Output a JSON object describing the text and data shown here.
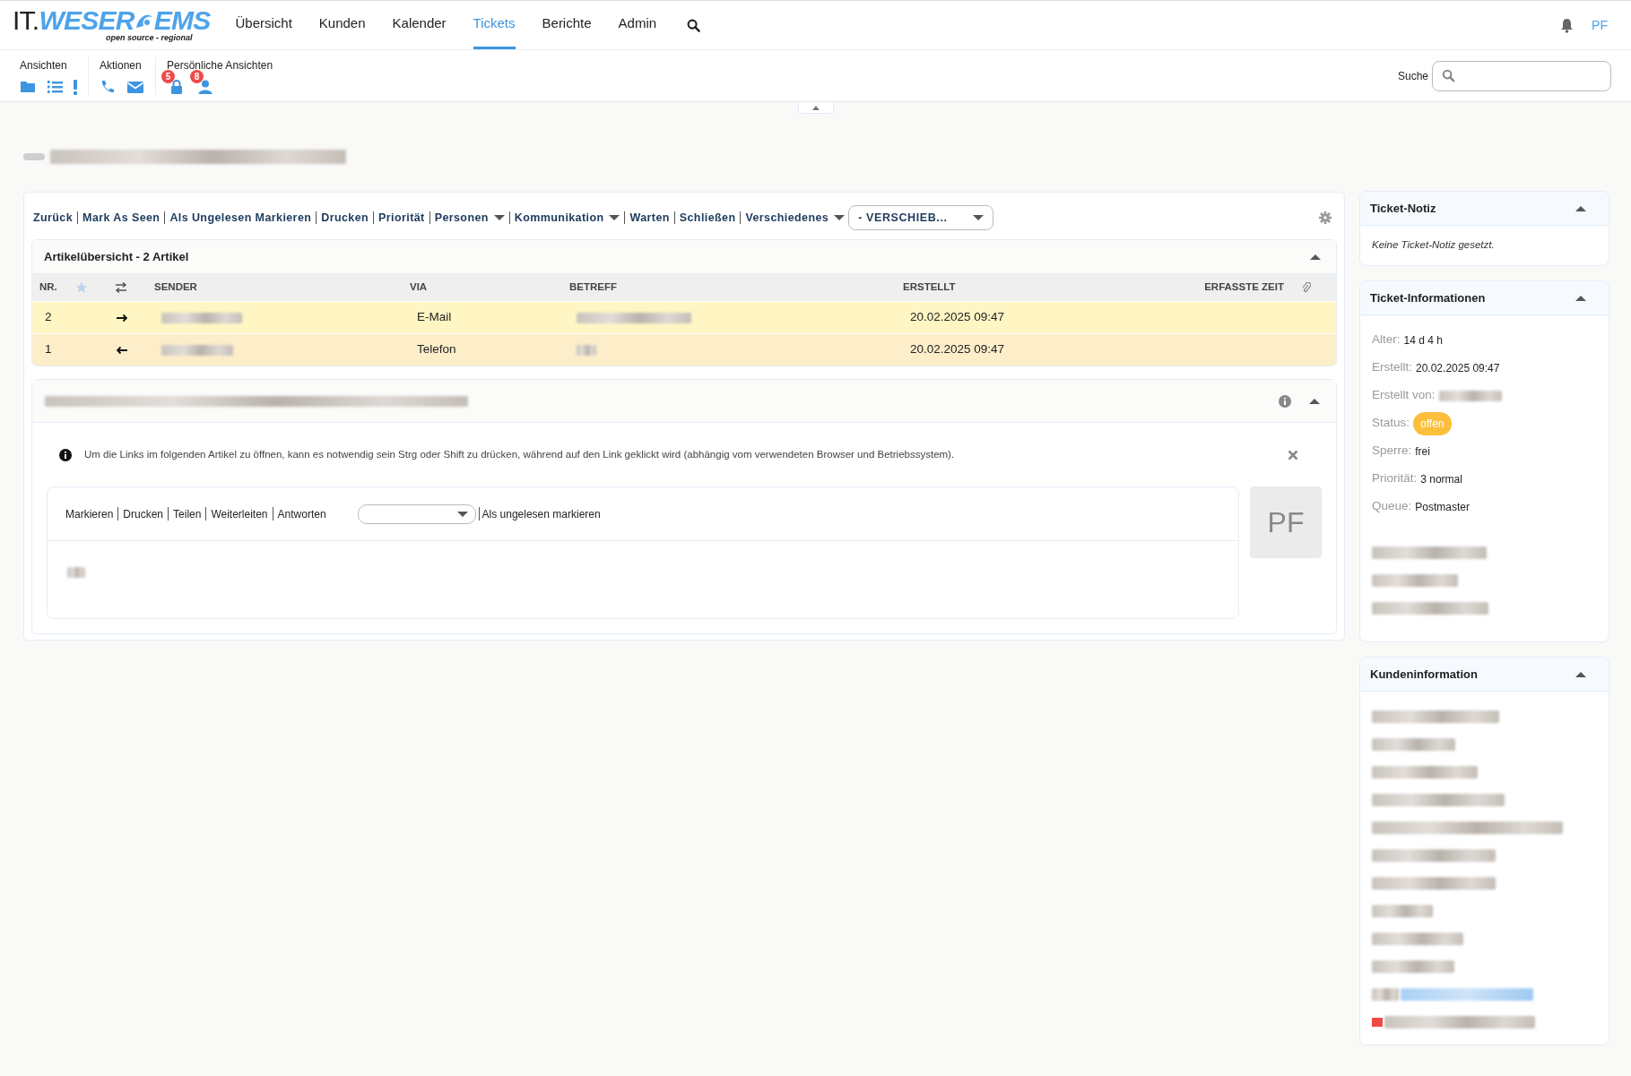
{
  "logo": {
    "prefix": "IT.",
    "main": "WESER",
    "suffix": "EMS",
    "tagline": "open source - regional"
  },
  "nav": [
    {
      "label": "Übersicht",
      "selected": false
    },
    {
      "label": "Kunden",
      "selected": false
    },
    {
      "label": "Kalender",
      "selected": false
    },
    {
      "label": "Tickets",
      "selected": true
    },
    {
      "label": "Berichte",
      "selected": false
    },
    {
      "label": "Admin",
      "selected": false
    }
  ],
  "user_initials": "PF",
  "toolbar_groups": [
    {
      "label": "Ansichten",
      "icons": [
        {
          "kind": "folder"
        },
        {
          "kind": "list"
        },
        {
          "kind": "exclamation"
        }
      ]
    },
    {
      "label": "Aktionen",
      "icons": [
        {
          "kind": "phone"
        },
        {
          "kind": "mail"
        }
      ]
    },
    {
      "label": "Persönliche Ansichten",
      "icons": [
        {
          "kind": "lock",
          "badge": "5"
        },
        {
          "kind": "user",
          "badge": "8"
        }
      ]
    }
  ],
  "search": {
    "label": "Suche"
  },
  "ticket_title": {
    "redacted": true
  },
  "actions": [
    {
      "label": "Zurück",
      "dropdown": false
    },
    {
      "label": "Mark As Seen",
      "dropdown": false
    },
    {
      "label": "Als Ungelesen Markieren",
      "dropdown": false
    },
    {
      "label": "Drucken",
      "dropdown": false
    },
    {
      "label": "Priorität",
      "dropdown": false
    },
    {
      "label": "Personen",
      "dropdown": true
    },
    {
      "label": "Kommunikation",
      "dropdown": true
    },
    {
      "label": "Warten",
      "dropdown": false
    },
    {
      "label": "Schließen",
      "dropdown": false
    },
    {
      "label": "Verschiedenes",
      "dropdown": true
    }
  ],
  "move_select": "- VERSCHIEB...",
  "article_overview": {
    "title": "Artikelübersicht - 2 Artikel",
    "columns": [
      "NR.",
      "SENDER",
      "VIA",
      "BETREFF",
      "ERSTELLT",
      "ERFASSTE ZEIT"
    ],
    "rows": [
      {
        "nr": "2",
        "kind": "outgoing",
        "sender_redacted": true,
        "via": "E-Mail",
        "subject_redacted": true,
        "created": "20.02.2025 09:47",
        "color": "#fff6c4"
      },
      {
        "nr": "1",
        "kind": "incoming",
        "sender_redacted": true,
        "via": "Telefon",
        "subject_redacted": true,
        "created": "20.02.2025 09:47",
        "color": "#fdeec9"
      }
    ]
  },
  "article": {
    "header_redacted": true,
    "notice": "Um die Links im folgenden Artikel zu öffnen, kann es notwendig sein Strg oder Shift zu drücken, während auf den Link geklickt wird (abhängig vom verwendeten Browser und Betriebssystem).",
    "actions": [
      "Markieren",
      "Drucken",
      "Teilen",
      "Weiterleiten",
      "Antworten"
    ],
    "mark_unread": "Als ungelesen markieren",
    "body_redacted": true,
    "avatar": "PF"
  },
  "ticket_note": {
    "title": "Ticket-Notiz",
    "text": "Keine Ticket-Notiz gesetzt."
  },
  "ticket_info": {
    "title": "Ticket-Informationen",
    "fields": [
      {
        "kind": "text",
        "label": "Alter:",
        "value": "14 d 4 h"
      },
      {
        "kind": "text",
        "label": "Erstellt:",
        "value": "20.02.2025 09:47"
      },
      {
        "kind": "redacted",
        "label": "Erstellt von:"
      },
      {
        "kind": "badge",
        "label": "Status:",
        "value": "offen",
        "color": "#fbbf3c"
      },
      {
        "kind": "text",
        "label": "Sperre:",
        "value": "frei"
      },
      {
        "kind": "text",
        "label": "Priorität:",
        "value": "3 normal"
      },
      {
        "kind": "text",
        "label": "Queue:",
        "value": "Postmaster"
      },
      {
        "kind": "hidden"
      },
      {
        "kind": "hidden"
      },
      {
        "kind": "hidden"
      }
    ]
  },
  "customer_info": {
    "title": "Kundeninformation",
    "lines": [
      {
        "kind": "hidden"
      },
      {
        "kind": "hidden"
      },
      {
        "kind": "hidden"
      },
      {
        "kind": "hidden"
      },
      {
        "kind": "hidden"
      },
      {
        "kind": "hidden"
      },
      {
        "kind": "hidden"
      },
      {
        "kind": "hidden"
      },
      {
        "kind": "hidden"
      },
      {
        "kind": "hidden"
      },
      {
        "kind": "hidden-link"
      },
      {
        "kind": "hidden-flag"
      }
    ]
  }
}
